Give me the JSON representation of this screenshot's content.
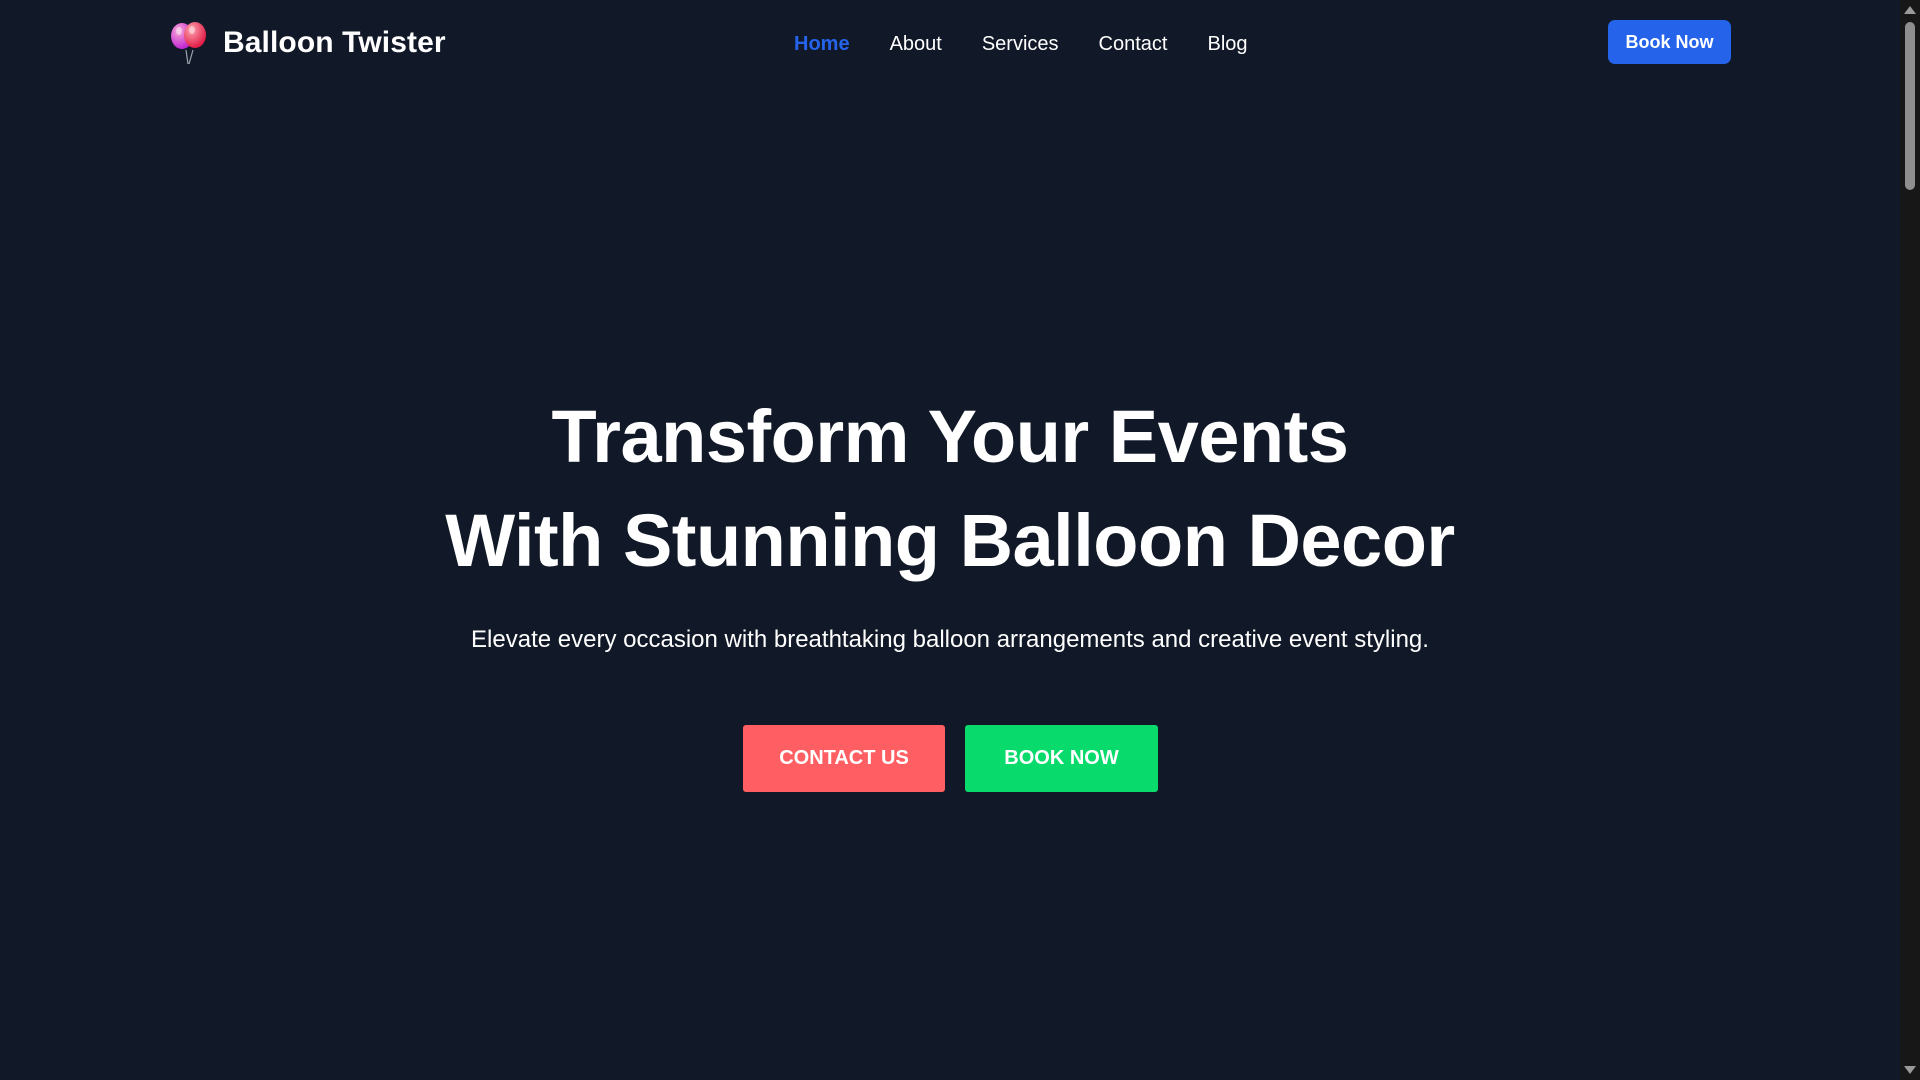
{
  "colors": {
    "background": "#111827",
    "accent": "#2563eb",
    "contact_button": "#ff5e62",
    "book_button": "#08db6b",
    "text": "#ffffff"
  },
  "brand": {
    "name": "Balloon Twister",
    "icon": "balloons-icon"
  },
  "nav": {
    "items": [
      {
        "label": "Home",
        "active": true
      },
      {
        "label": "About",
        "active": false
      },
      {
        "label": "Services",
        "active": false
      },
      {
        "label": "Contact",
        "active": false
      },
      {
        "label": "Blog",
        "active": false
      }
    ],
    "cta_label": "Book Now"
  },
  "hero": {
    "title_line1": "Transform Your Events",
    "title_line2": "With Stunning Balloon Decor",
    "subtitle": "Elevate every occasion with breathtaking balloon arrangements and creative event styling.",
    "contact_label": "CONTACT US",
    "book_label": "BOOK NOW"
  }
}
